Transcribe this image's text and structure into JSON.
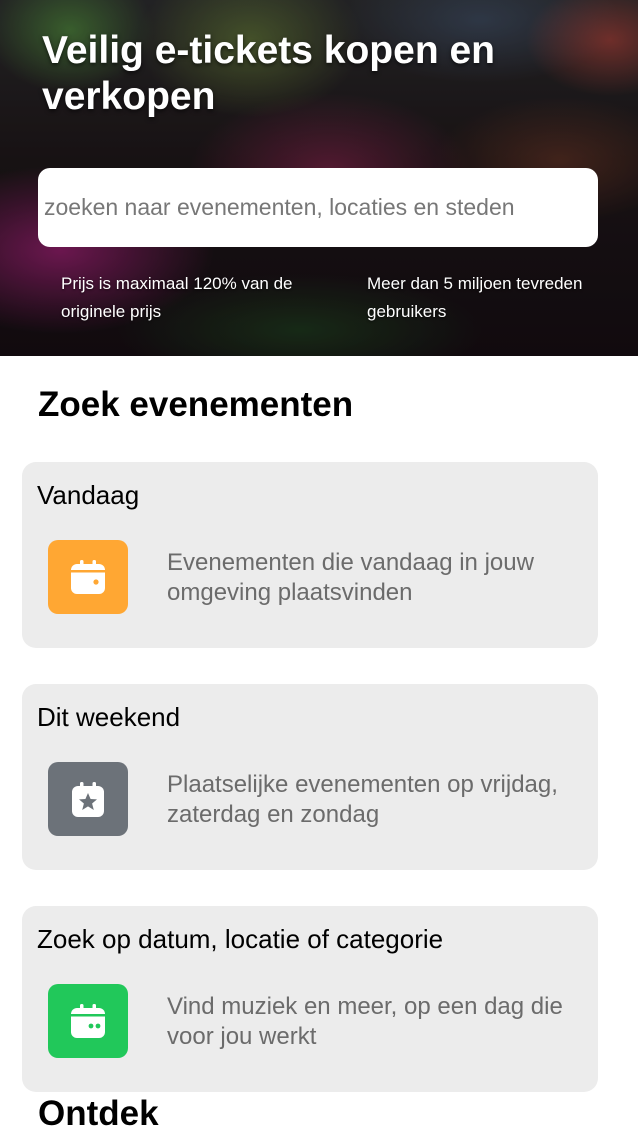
{
  "hero": {
    "title": "Veilig e-tickets kopen en verkopen",
    "search_placeholder": "zoeken naar evenementen, locaties en steden",
    "usps": [
      "Prijs is maximaal 120% van de originele prijs",
      "Meer dan 5 miljoen tevreden gebruikers"
    ]
  },
  "sections": {
    "zoek_title": "Zoek evenementen",
    "ontdek_title": "Ontdek"
  },
  "cards": [
    {
      "title": "Vandaag",
      "description": "Evenementen die vandaag in jouw omgeving plaatsvinden",
      "icon": "calendar-icon",
      "icon_color": "#ffa733"
    },
    {
      "title": "Dit weekend",
      "description": "Plaatselijke evenementen op vrijdag, zaterdag en zondag",
      "icon": "calendar-star-icon",
      "icon_color": "#6c7279"
    },
    {
      "title": "Zoek op datum, locatie of categorie",
      "description": "Vind muziek en meer, op een dag die voor jou werkt",
      "icon": "calendar-dots-icon",
      "icon_color": "#21c85a"
    }
  ]
}
